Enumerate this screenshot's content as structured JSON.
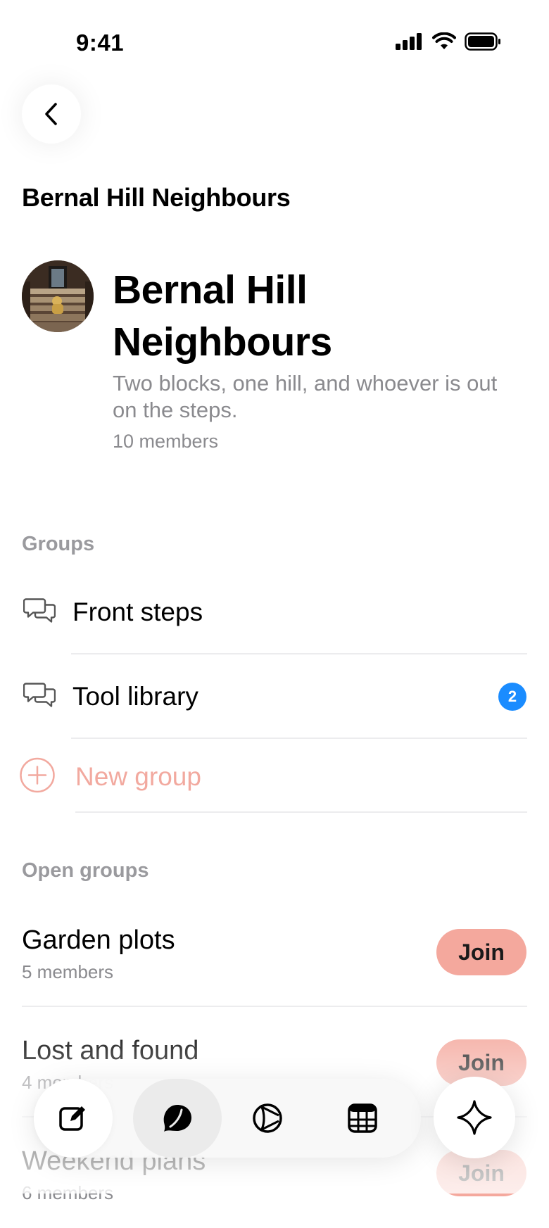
{
  "status_bar": {
    "time": "9:41"
  },
  "nav": {
    "title": "Bernal Hill Neighbours"
  },
  "community": {
    "name": "Bernal Hill Neighbours",
    "description": "Two blocks, one hill, and whoever is out on the steps.",
    "members": "10 members"
  },
  "groups": {
    "label": "Groups",
    "items": [
      {
        "label": "Front steps",
        "icon": "chat-bubbles-icon"
      },
      {
        "label": "Tool library",
        "icon": "chat-bubbles-icon",
        "badge": "2"
      }
    ],
    "new_group_label": "New group"
  },
  "open_groups": {
    "label": "Open groups",
    "items": [
      {
        "name": "Garden plots",
        "members": "5 members",
        "action": "Join"
      },
      {
        "name": "Lost and found",
        "members": "4 members",
        "action": "Join"
      },
      {
        "name": "Weekend plans",
        "members": "6 members",
        "action": "Join"
      }
    ]
  },
  "tab_bar": {
    "tabs": [
      "compose-icon",
      "chats-icon",
      "explore-icon",
      "calendar-icon"
    ],
    "active": "chats-icon",
    "fab_icon": "sparkle-diamond-icon"
  },
  "colors": {
    "accent": "#f4a89d",
    "accent_text": "#f2a99f",
    "badge": "#1a8cff",
    "secondary_text": "#8a8a8e"
  }
}
